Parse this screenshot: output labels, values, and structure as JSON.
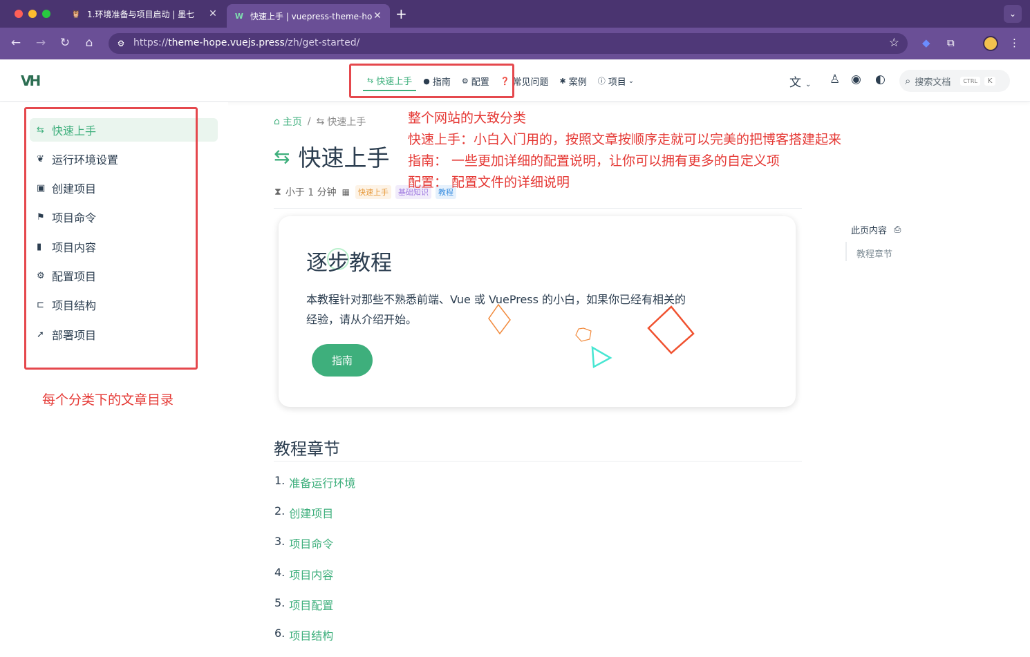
{
  "browser": {
    "tabs": [
      {
        "title": "1.环境准备与项目启动 | 墨七",
        "active": false
      },
      {
        "title": "快速上手 | vuepress-theme-hope",
        "active": true
      }
    ],
    "url_prefix": "https://",
    "url_host": "theme-hope.vuejs.press",
    "url_path": "/zh/get-started/"
  },
  "navbar": {
    "logo": "VH",
    "links": [
      {
        "label": "快速上手",
        "icon": "signpost-icon",
        "active": true
      },
      {
        "label": "指南",
        "icon": "lightbulb-icon",
        "active": false
      },
      {
        "label": "配置",
        "icon": "gears-icon",
        "active": false
      },
      {
        "label": "常见问题",
        "icon": "question-circle-icon",
        "active": false
      },
      {
        "label": "案例",
        "icon": "puzzle-icon",
        "active": false
      },
      {
        "label": "项目",
        "icon": "info-circle-icon",
        "active": false
      }
    ],
    "search_placeholder": "搜索文档",
    "search_key1": "CTRL",
    "search_key2": "K"
  },
  "sidebar": {
    "items": [
      {
        "label": "快速上手",
        "icon": "signpost-icon",
        "active": true
      },
      {
        "label": "运行环境设置",
        "icon": "leaf-icon"
      },
      {
        "label": "创建项目",
        "icon": "folder-plus-icon"
      },
      {
        "label": "项目命令",
        "icon": "flag-icon"
      },
      {
        "label": "项目内容",
        "icon": "file-icon"
      },
      {
        "label": "配置项目",
        "icon": "gears-icon"
      },
      {
        "label": "项目结构",
        "icon": "sitemap-icon"
      },
      {
        "label": "部署项目",
        "icon": "rocket-icon"
      }
    ]
  },
  "main": {
    "breadcrumb": {
      "home": "主页",
      "sep": "/",
      "current": "快速上手"
    },
    "title": "快速上手",
    "meta": {
      "reading_time": "小于 1 分钟",
      "tags": [
        "快速上手",
        "基础知识",
        "教程"
      ]
    },
    "card": {
      "title": "逐步教程",
      "desc": "本教程针对那些不熟悉前端、Vue 或 VuePress 的小白，如果你已经有相关的经验，请从介绍开始。",
      "button": "指南"
    },
    "section_title": "教程章节",
    "toc": [
      {
        "num": "1.",
        "label": "准备运行环境"
      },
      {
        "num": "2.",
        "label": "创建项目"
      },
      {
        "num": "3.",
        "label": "项目命令"
      },
      {
        "num": "4.",
        "label": "项目内容"
      },
      {
        "num": "5.",
        "label": "项目配置"
      },
      {
        "num": "6.",
        "label": "项目结构"
      }
    ]
  },
  "right_toc": {
    "heading": "此页内容",
    "items": [
      "教程章节"
    ]
  },
  "annotations": {
    "nav_note": [
      "整个网站的大致分类",
      "快速上手：小白入门用的，按照文章按顺序走就可以完美的把博客搭建起来",
      "指南：  一些更加详细的配置说明，让你可以拥有更多的自定义项",
      "配置：  配置文件的详细说明"
    ],
    "sidebar_note": "每个分类下的文章目录"
  },
  "colors": {
    "accent": "#3eaf7c",
    "annotation": "#e53935",
    "chrome": "#6a4f96"
  }
}
